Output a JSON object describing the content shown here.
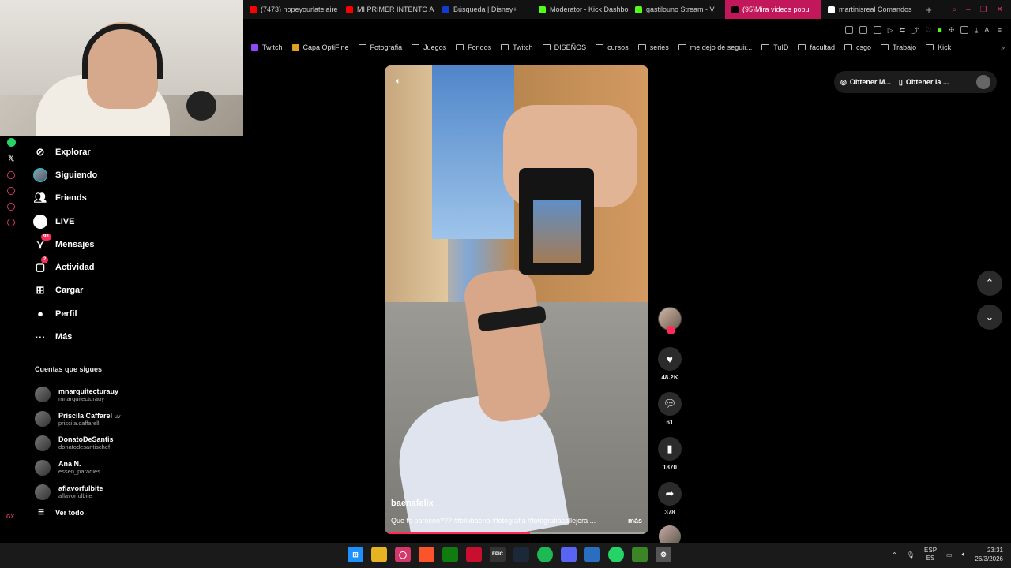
{
  "browser": {
    "tabs": [
      {
        "label": "(7473) nopeyourlateiaire",
        "color": "#ff0000",
        "active": false
      },
      {
        "label": "MI PRIMER INTENTO A P",
        "color": "#ff0000",
        "active": false
      },
      {
        "label": "Búsqueda | Disney+",
        "color": "#113ccf",
        "active": false
      },
      {
        "label": "Moderator - Kick Dashbo",
        "color": "#53fc18",
        "active": false
      },
      {
        "label": "gastilouno Stream - V",
        "color": "#53fc18",
        "active": false
      },
      {
        "label": "(95)Mira videos popul",
        "color": "#000000",
        "active": true
      },
      {
        "label": "martinisreal Comandos",
        "color": "#ffffff",
        "active": false
      }
    ],
    "new_tab": "+",
    "ai_label": "AI",
    "bookmarks": [
      {
        "label": "Twitch",
        "icon": "twitch-icon"
      },
      {
        "label": "Capa OptiFine",
        "icon": "optifine-icon"
      },
      {
        "label": "Fotografia",
        "icon": "folder-icon"
      },
      {
        "label": "Juegos",
        "icon": "folder-icon"
      },
      {
        "label": "Fondos",
        "icon": "folder-icon"
      },
      {
        "label": "Twitch",
        "icon": "folder-icon"
      },
      {
        "label": "DISEÑOS",
        "icon": "folder-icon"
      },
      {
        "label": "cursos",
        "icon": "folder-icon"
      },
      {
        "label": "series",
        "icon": "folder-icon"
      },
      {
        "label": "me dejo de seguir...",
        "icon": "folder-icon"
      },
      {
        "label": "TuID",
        "icon": "folder-icon"
      },
      {
        "label": "facultad",
        "icon": "folder-icon"
      },
      {
        "label": "csgo",
        "icon": "folder-icon"
      },
      {
        "label": "Trabajo",
        "icon": "folder-icon"
      },
      {
        "label": "Kick",
        "icon": "folder-icon"
      }
    ]
  },
  "sidebar": {
    "items": [
      {
        "label": "Explorar",
        "icon": "compass-icon"
      },
      {
        "label": "Siguiendo",
        "icon": "following-avatar-icon"
      },
      {
        "label": "Friends",
        "icon": "friends-icon"
      },
      {
        "label": "LIVE",
        "icon": "live-icon"
      },
      {
        "label": "Mensajes",
        "icon": "messages-icon",
        "badge": "93"
      },
      {
        "label": "Actividad",
        "icon": "activity-icon",
        "badge": "2"
      },
      {
        "label": "Cargar",
        "icon": "upload-icon"
      },
      {
        "label": "Perfil",
        "icon": "profile-icon"
      },
      {
        "label": "Más",
        "icon": "more-icon"
      }
    ],
    "following_title": "Cuentas que sigues",
    "following": [
      {
        "name": "mnarquitecturauy",
        "handle": "mnarquitecturauy",
        "suffix": ""
      },
      {
        "name": "Priscila Caffarel",
        "handle": "priscila.caffarell",
        "suffix": "uv"
      },
      {
        "name": "DonatoDeSantis",
        "handle": "donatodesantischef",
        "suffix": ""
      },
      {
        "name": "Ana N.",
        "handle": "essen_paradies",
        "suffix": ""
      },
      {
        "name": "aflavorfulbite",
        "handle": "aflavorfulbite",
        "suffix": ""
      }
    ],
    "see_all": "Ver todo"
  },
  "top_pill": {
    "item1": "Obtener M...",
    "item2": "Obtener la ..."
  },
  "video": {
    "author": "baenafelix",
    "caption": "Que te parecen??? #felixbaena #fotografia #fotografiacallejera ...",
    "more": "más",
    "progress": 0.55
  },
  "actions": {
    "likes": "48.2K",
    "comments": "61",
    "saves": "1870",
    "shares": "378"
  },
  "taskbar": {
    "lang_top": "ESP",
    "lang_bottom": "ES",
    "time": "23:31",
    "date": "26/3/2026",
    "epic_label": "EPIC"
  },
  "rail": {
    "gx": "GX"
  },
  "colors": {
    "accent": "#fe2c55",
    "opera_red": "#d4386b",
    "active_tab": "#c2185b"
  }
}
